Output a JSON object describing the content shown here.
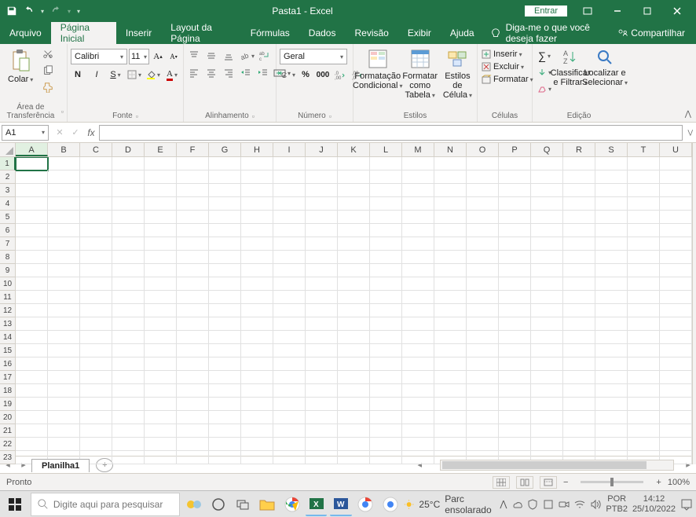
{
  "titlebar": {
    "title": "Pasta1  -  Excel",
    "signin": "Entrar"
  },
  "tabs": {
    "file": "Arquivo",
    "items": [
      "Página Inicial",
      "Inserir",
      "Layout da Página",
      "Fórmulas",
      "Dados",
      "Revisão",
      "Exibir",
      "Ajuda"
    ],
    "active": 0,
    "tellme": "Diga-me o que você deseja fazer",
    "share": "Compartilhar"
  },
  "ribbon": {
    "clipboard": {
      "paste": "Colar",
      "label": "Área de Transferência"
    },
    "font": {
      "name": "Calibri",
      "size": "11",
      "label": "Fonte"
    },
    "alignment": {
      "label": "Alinhamento"
    },
    "number": {
      "format": "Geral",
      "label": "Número"
    },
    "styles": {
      "cond": "Formatação Condicional",
      "table": "Formatar como Tabela",
      "cell": "Estilos de Célula",
      "label": "Estilos"
    },
    "cells": {
      "insert": "Inserir",
      "delete": "Excluir",
      "format": "Formatar",
      "label": "Células"
    },
    "editing": {
      "sort": "Classificar e Filtrar",
      "find": "Localizar e Selecionar",
      "label": "Edição"
    }
  },
  "formula": {
    "namebox": "A1"
  },
  "grid": {
    "cols": [
      "A",
      "B",
      "C",
      "D",
      "E",
      "F",
      "G",
      "H",
      "I",
      "J",
      "K",
      "L",
      "M",
      "N",
      "O",
      "P",
      "Q",
      "R",
      "S",
      "T",
      "U"
    ],
    "rows": 23,
    "active": {
      "row": 1,
      "col": 0
    }
  },
  "sheet": {
    "name": "Planilha1"
  },
  "status": {
    "ready": "Pronto",
    "zoom": "100%"
  },
  "taskbar": {
    "search": "Digite aqui para pesquisar",
    "weather_temp": "25°C",
    "weather_text": "Parc ensolarado",
    "lang1": "POR",
    "lang2": "PTB2",
    "time": "14:12",
    "date": "25/10/2022"
  }
}
